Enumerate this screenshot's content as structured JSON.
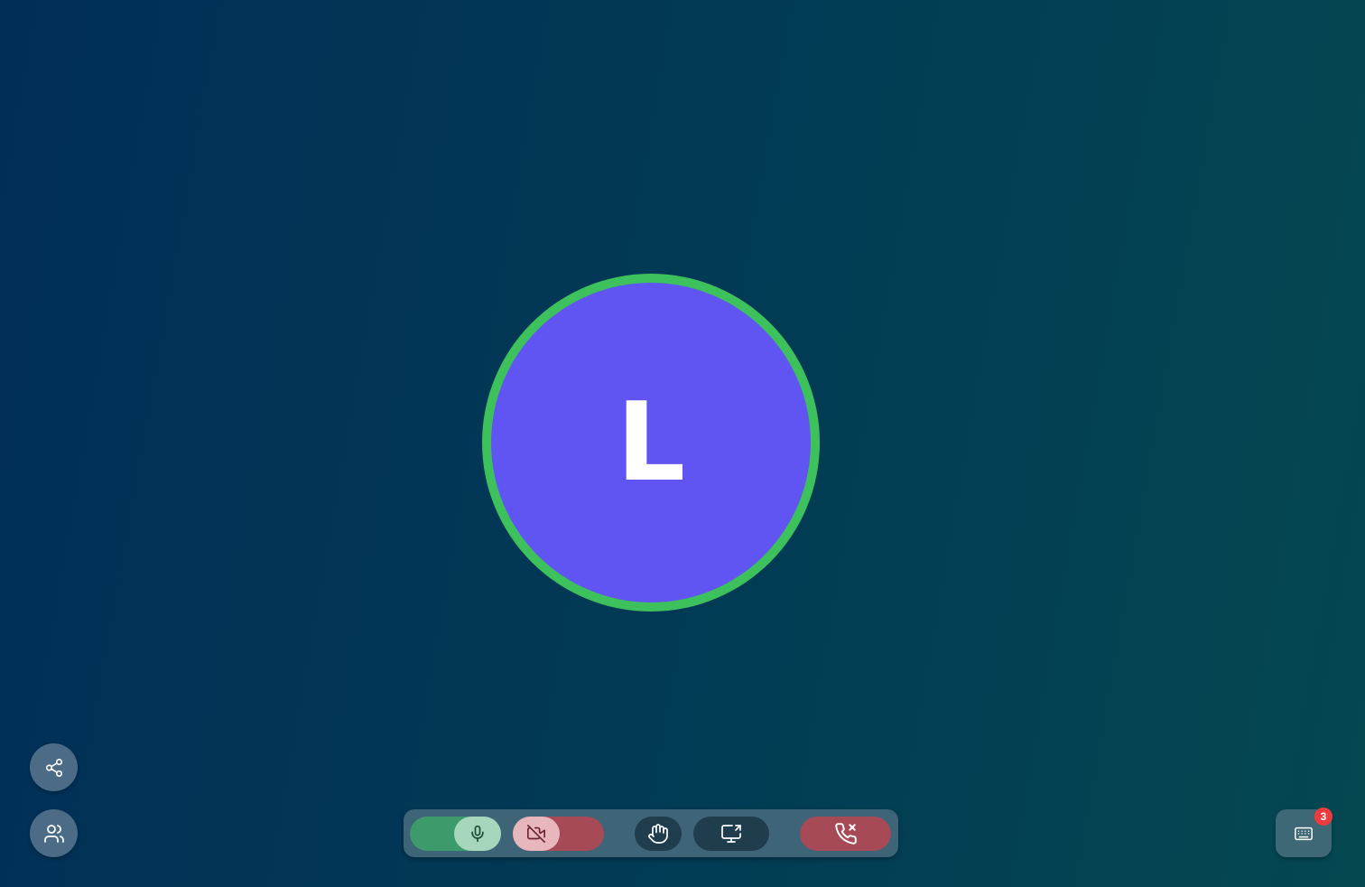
{
  "participant": {
    "initial": "L",
    "speaking_ring_color": "#3cc15c",
    "avatar_color": "#6055f2"
  },
  "side_controls": {
    "share_icon": "share-icon",
    "participants_icon": "users-icon"
  },
  "toolbar": {
    "mic": {
      "icon": "microphone-icon",
      "state": "on",
      "color": "#3d9a6b"
    },
    "camera": {
      "icon": "video-off-icon",
      "state": "off",
      "color": "#a54a56"
    },
    "raise_hand_icon": "hand-icon",
    "screen_share_icon": "screen-share-icon",
    "end_call": {
      "icon": "phone-x-icon",
      "color": "#a54a56"
    }
  },
  "keyboard": {
    "icon": "keyboard-icon",
    "badge_count": "3"
  }
}
